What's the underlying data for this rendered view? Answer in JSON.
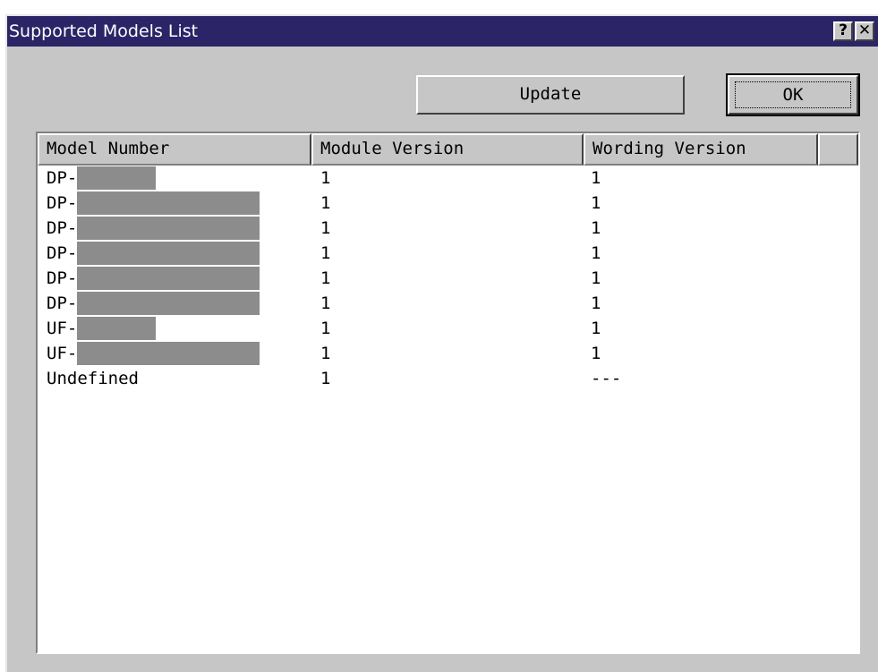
{
  "window": {
    "title": "Supported Models List",
    "help_glyph": "?",
    "close_glyph": "✕"
  },
  "buttons": {
    "update_label": "Update",
    "ok_label": "OK"
  },
  "table": {
    "columns": [
      "Model Number",
      "Module Version",
      "Wording Version",
      ""
    ],
    "rows": [
      {
        "model": "DP-",
        "module_version": "1",
        "wording_version": "1",
        "redacted": "short"
      },
      {
        "model": "DP-",
        "module_version": "1",
        "wording_version": "1",
        "redacted": "long"
      },
      {
        "model": "DP-",
        "module_version": "1",
        "wording_version": "1",
        "redacted": "long"
      },
      {
        "model": "DP-",
        "module_version": "1",
        "wording_version": "1",
        "redacted": "long"
      },
      {
        "model": "DP-",
        "module_version": "1",
        "wording_version": "1",
        "redacted": "long"
      },
      {
        "model": "DP-",
        "module_version": "1",
        "wording_version": "1",
        "redacted": "long"
      },
      {
        "model": "UF-",
        "module_version": "1",
        "wording_version": "1",
        "redacted": "short"
      },
      {
        "model": "UF-",
        "module_version": "1",
        "wording_version": "1",
        "redacted": "long"
      },
      {
        "model": "Undefined",
        "module_version": "1",
        "wording_version": "---",
        "redacted": "none"
      }
    ]
  },
  "colors": {
    "titlebar": "#2b2467",
    "face": "#c6c6c6",
    "redaction": "#8c8c8c"
  }
}
